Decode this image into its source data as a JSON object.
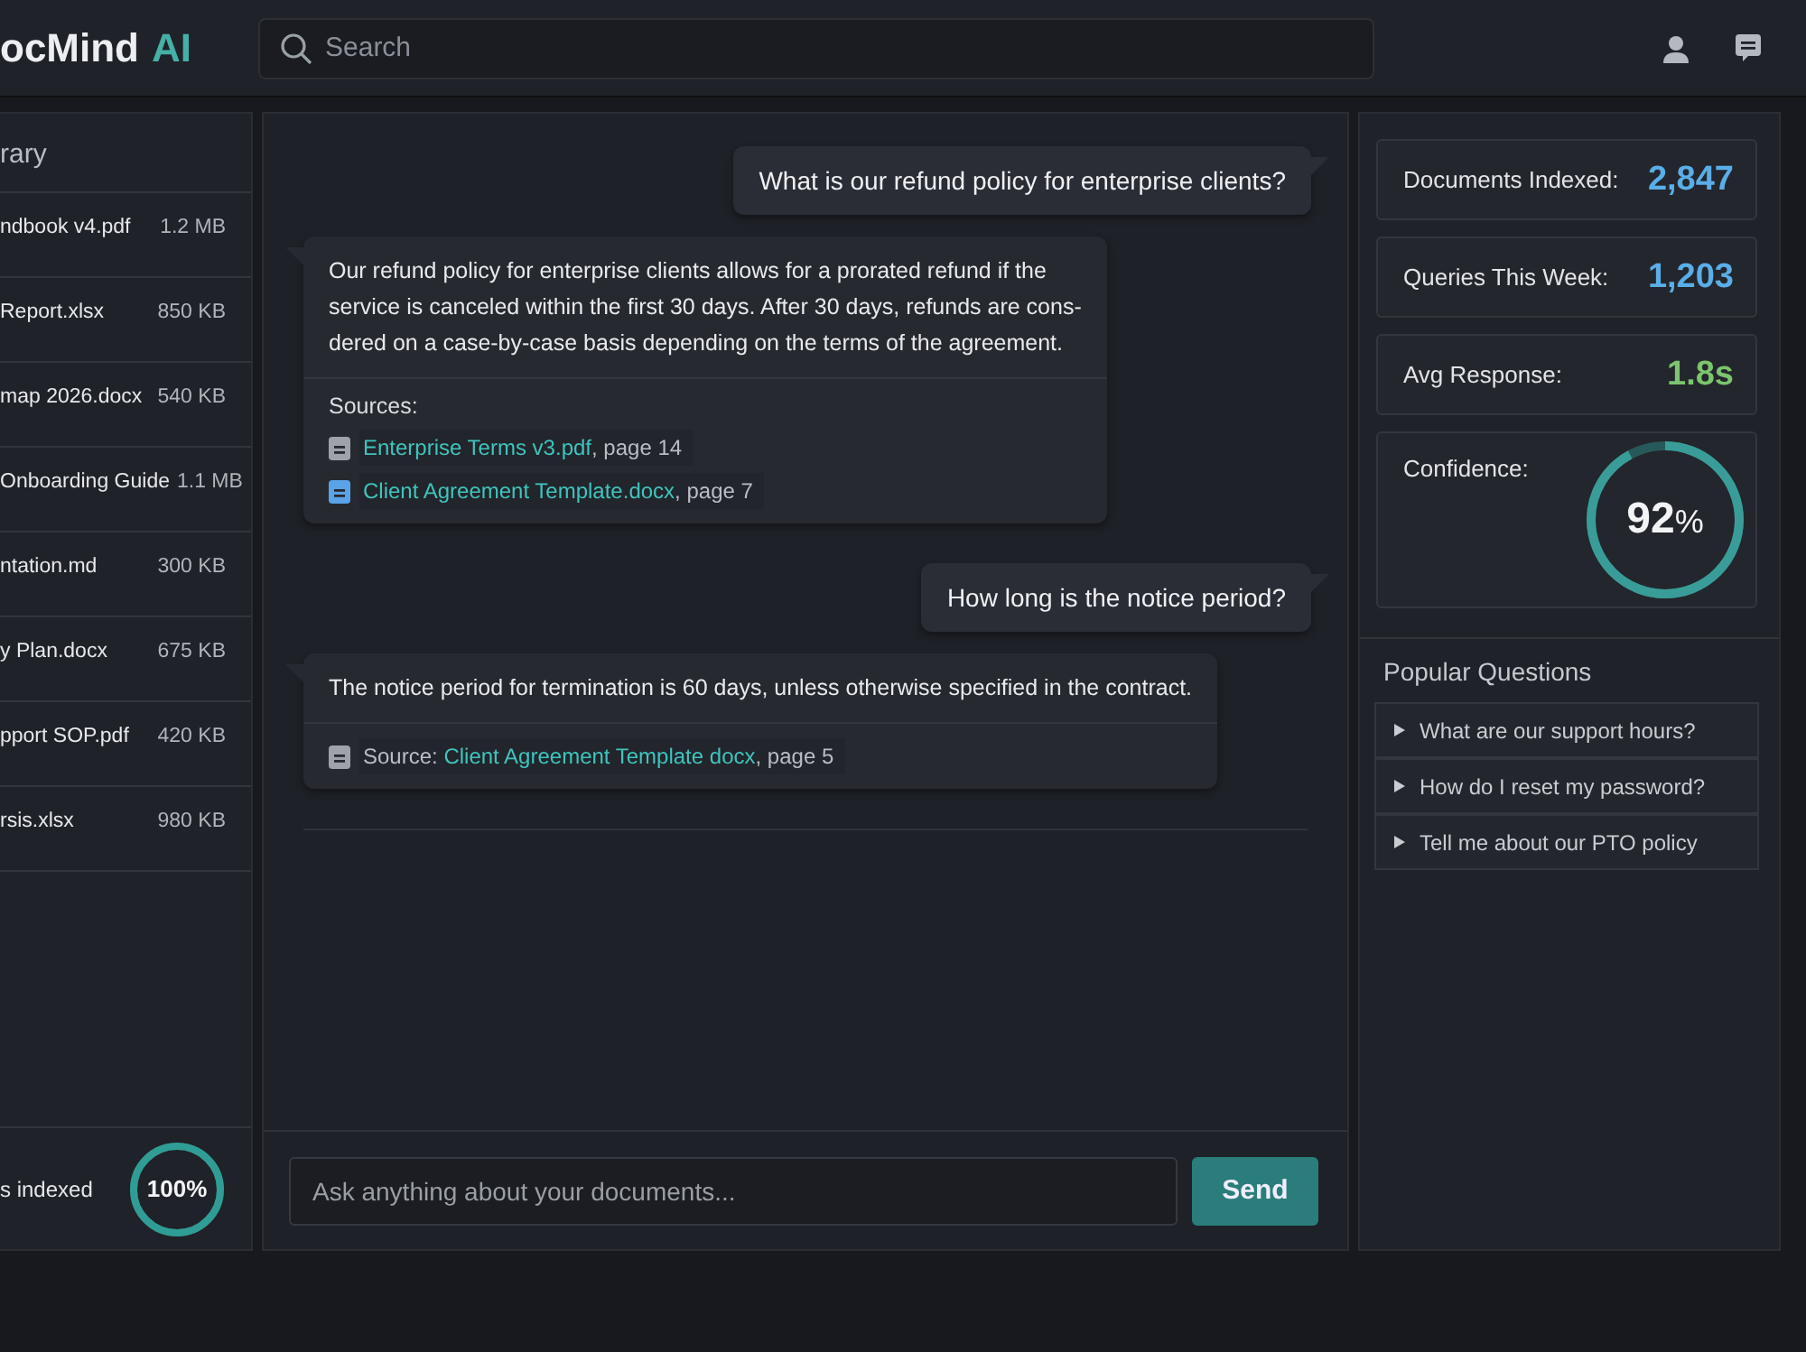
{
  "header": {
    "logo": {
      "name": "ocMind",
      "accent": "AI"
    },
    "search": {
      "placeholder": "Search"
    }
  },
  "library": {
    "title": "rary",
    "files": [
      {
        "name": "ndbook v4.pdf",
        "size": "1.2 MB"
      },
      {
        "name": "Report.xlsx",
        "size": "850 KB"
      },
      {
        "name": "map 2026.docx",
        "size": "540 KB"
      },
      {
        "name": "Onboarding Guide",
        "size": "1.1 MB"
      },
      {
        "name": "ntation.md",
        "size": "300 KB"
      },
      {
        "name": "y Plan.docx",
        "size": "675 KB"
      },
      {
        "name": "pport SOP.pdf",
        "size": "420 KB"
      },
      {
        "name": "rsis.xlsx",
        "size": "980 KB"
      }
    ],
    "footer": {
      "label": "s indexed",
      "reading": "100%",
      "level": 1
    }
  },
  "chat": {
    "messages": [
      {
        "kind": "user",
        "text": "What is our refund policy for enterprise clients?"
      },
      {
        "kind": "assistant",
        "lines": [
          "Our refund policy for enterprise clients allows for a prorated refund if the",
          "service is canceled within the first 30 days. After 30 days, refunds are cons-",
          "dered on a case-by-case basis depending on the terms of the agreement."
        ],
        "sources_label": "Sources:",
        "sources": [
          {
            "link": "Enterprise Terms v3.pdf",
            "page": ", page 14",
            "color": "#9ea3ab"
          },
          {
            "link": "Client Agreement Template.docx",
            "page": ", page 7",
            "color": "#5aa3e6"
          }
        ]
      },
      {
        "kind": "user",
        "text": "How long is the notice period?"
      },
      {
        "kind": "assistant",
        "lines": [
          "The notice period for termination is 60 days, unless otherwise specified in the contract."
        ],
        "sources": [
          {
            "prefix": "Source:",
            "link": "Client Agreement Template docx",
            "page": ", page 5",
            "color": "#9ea3ab"
          }
        ]
      }
    ],
    "input": {
      "placeholder": "Ask anything about your documents..."
    },
    "send": "Send"
  },
  "stats": [
    {
      "kind": "number",
      "label": "Documents Indexed:",
      "value": "2,847",
      "color": "#5aaee8"
    },
    {
      "kind": "number",
      "label": "Queries This Week:",
      "value": "1,203",
      "color": "#5aaee8"
    },
    {
      "kind": "number",
      "label": "Avg Response:",
      "value": "1.8s",
      "color": "#7cc46e"
    },
    {
      "kind": "ring",
      "label": "Confidence:",
      "value": "92",
      "unit": "%",
      "level": 0.92
    }
  ],
  "popular": {
    "title": "Popular Questions",
    "items": [
      "What are our support hours?",
      "How do I reset my password?",
      "Tell me about our PTO policy"
    ]
  }
}
